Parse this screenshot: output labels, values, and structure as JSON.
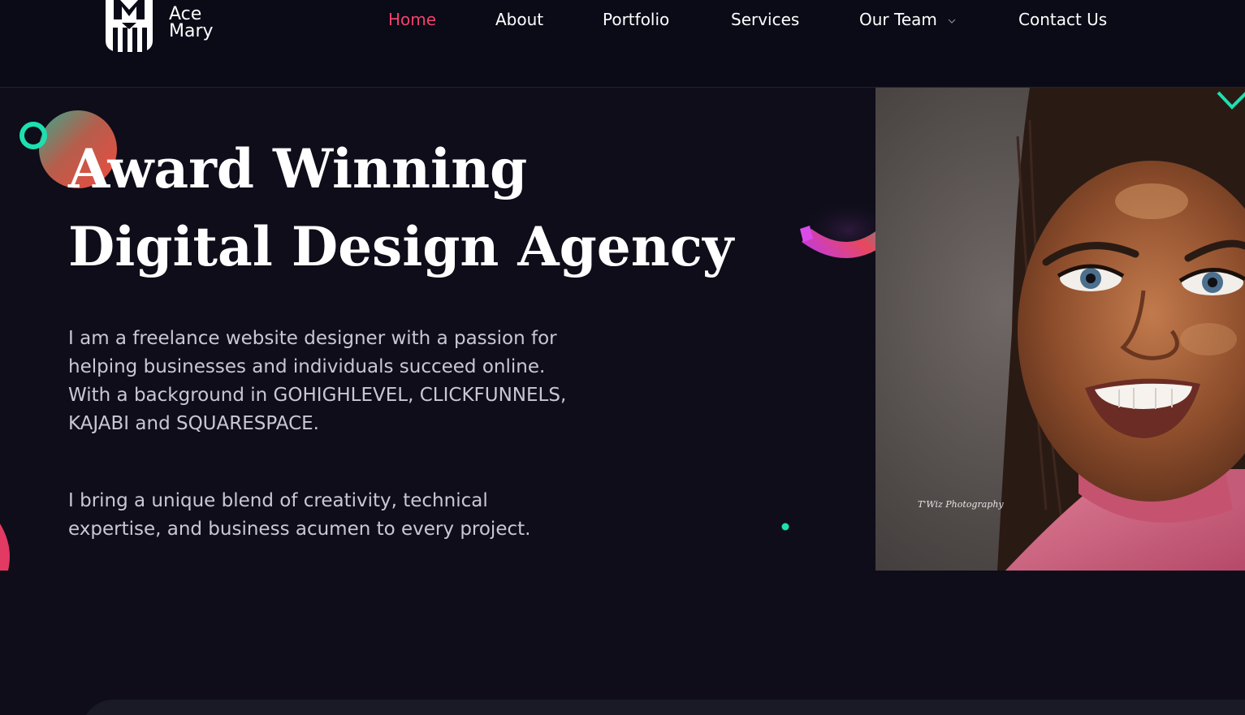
{
  "brand": {
    "name_line1": "Ace",
    "name_line2": "Mary"
  },
  "nav": {
    "items": [
      {
        "label": "Home",
        "active": true
      },
      {
        "label": "About",
        "active": false
      },
      {
        "label": "Portfolio",
        "active": false
      },
      {
        "label": "Services",
        "active": false
      },
      {
        "label": "Our Team",
        "active": false,
        "has_dropdown": true,
        "dropdown_icon": "chevron-down-icon"
      },
      {
        "label": "Contact Us",
        "active": false
      }
    ]
  },
  "hero": {
    "title_line1": "Award Winning",
    "title_line2": "Digital Design Agency",
    "paragraph1": "I am a freelance website designer with a passion for helping businesses and individuals succeed online. With a background in GOHIGHLEVEL, CLICKFUNNELS, KAJABI and SQUARESPACE.",
    "paragraph2": "I bring a unique blend of creativity, technical expertise, and business acumen to every project.",
    "photo_credit": "T'Wiz Photography"
  },
  "colors": {
    "background": "#0e0d19",
    "header_background": "#0b0a17",
    "accent_pink": "#f0436c",
    "accent_teal": "#1de0b0",
    "text_muted": "#c9c8d2"
  }
}
